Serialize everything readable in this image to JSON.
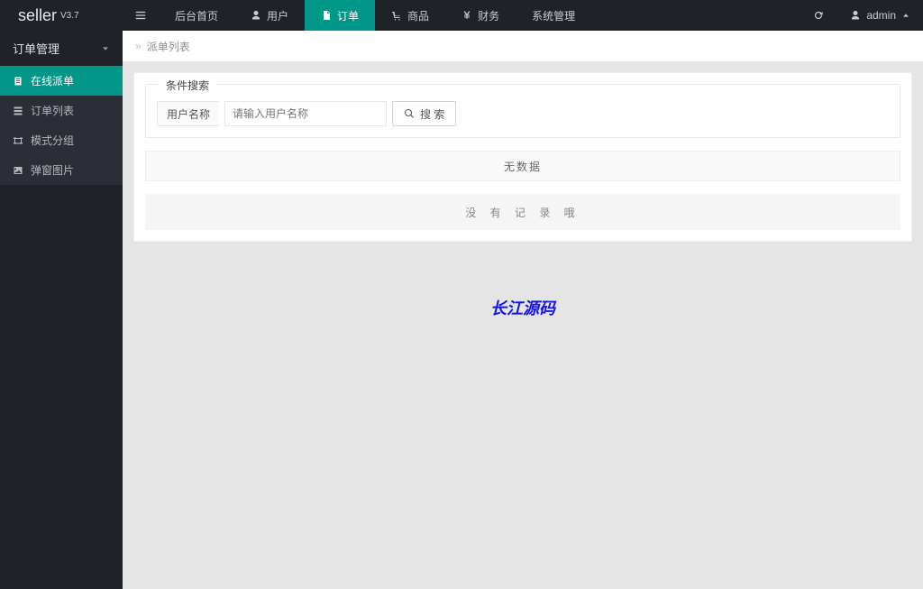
{
  "brand": {
    "name": "seller",
    "version": "V3.7"
  },
  "header": {
    "nav": [
      {
        "label": "后台首页"
      },
      {
        "label": "用户"
      },
      {
        "label": "订单",
        "active": true
      },
      {
        "label": "商品"
      },
      {
        "label": "财务"
      },
      {
        "label": "系统管理"
      }
    ],
    "user": "admin"
  },
  "sidebar": {
    "group": "订单管理",
    "items": [
      {
        "label": "在线派单",
        "active": true,
        "icon": "file"
      },
      {
        "label": "订单列表",
        "icon": "list"
      },
      {
        "label": "模式分组",
        "icon": "group"
      },
      {
        "label": "弹窗图片",
        "icon": "image"
      }
    ]
  },
  "tabs": {
    "current": "派单列表"
  },
  "search": {
    "fieldset_title": "条件搜索",
    "label": "用户名称",
    "placeholder": "请输入用户名称",
    "button": "搜 索"
  },
  "table": {
    "no_data_head": "无数据",
    "no_data_body": "没 有 记 录 哦"
  },
  "watermark": "长江源码"
}
